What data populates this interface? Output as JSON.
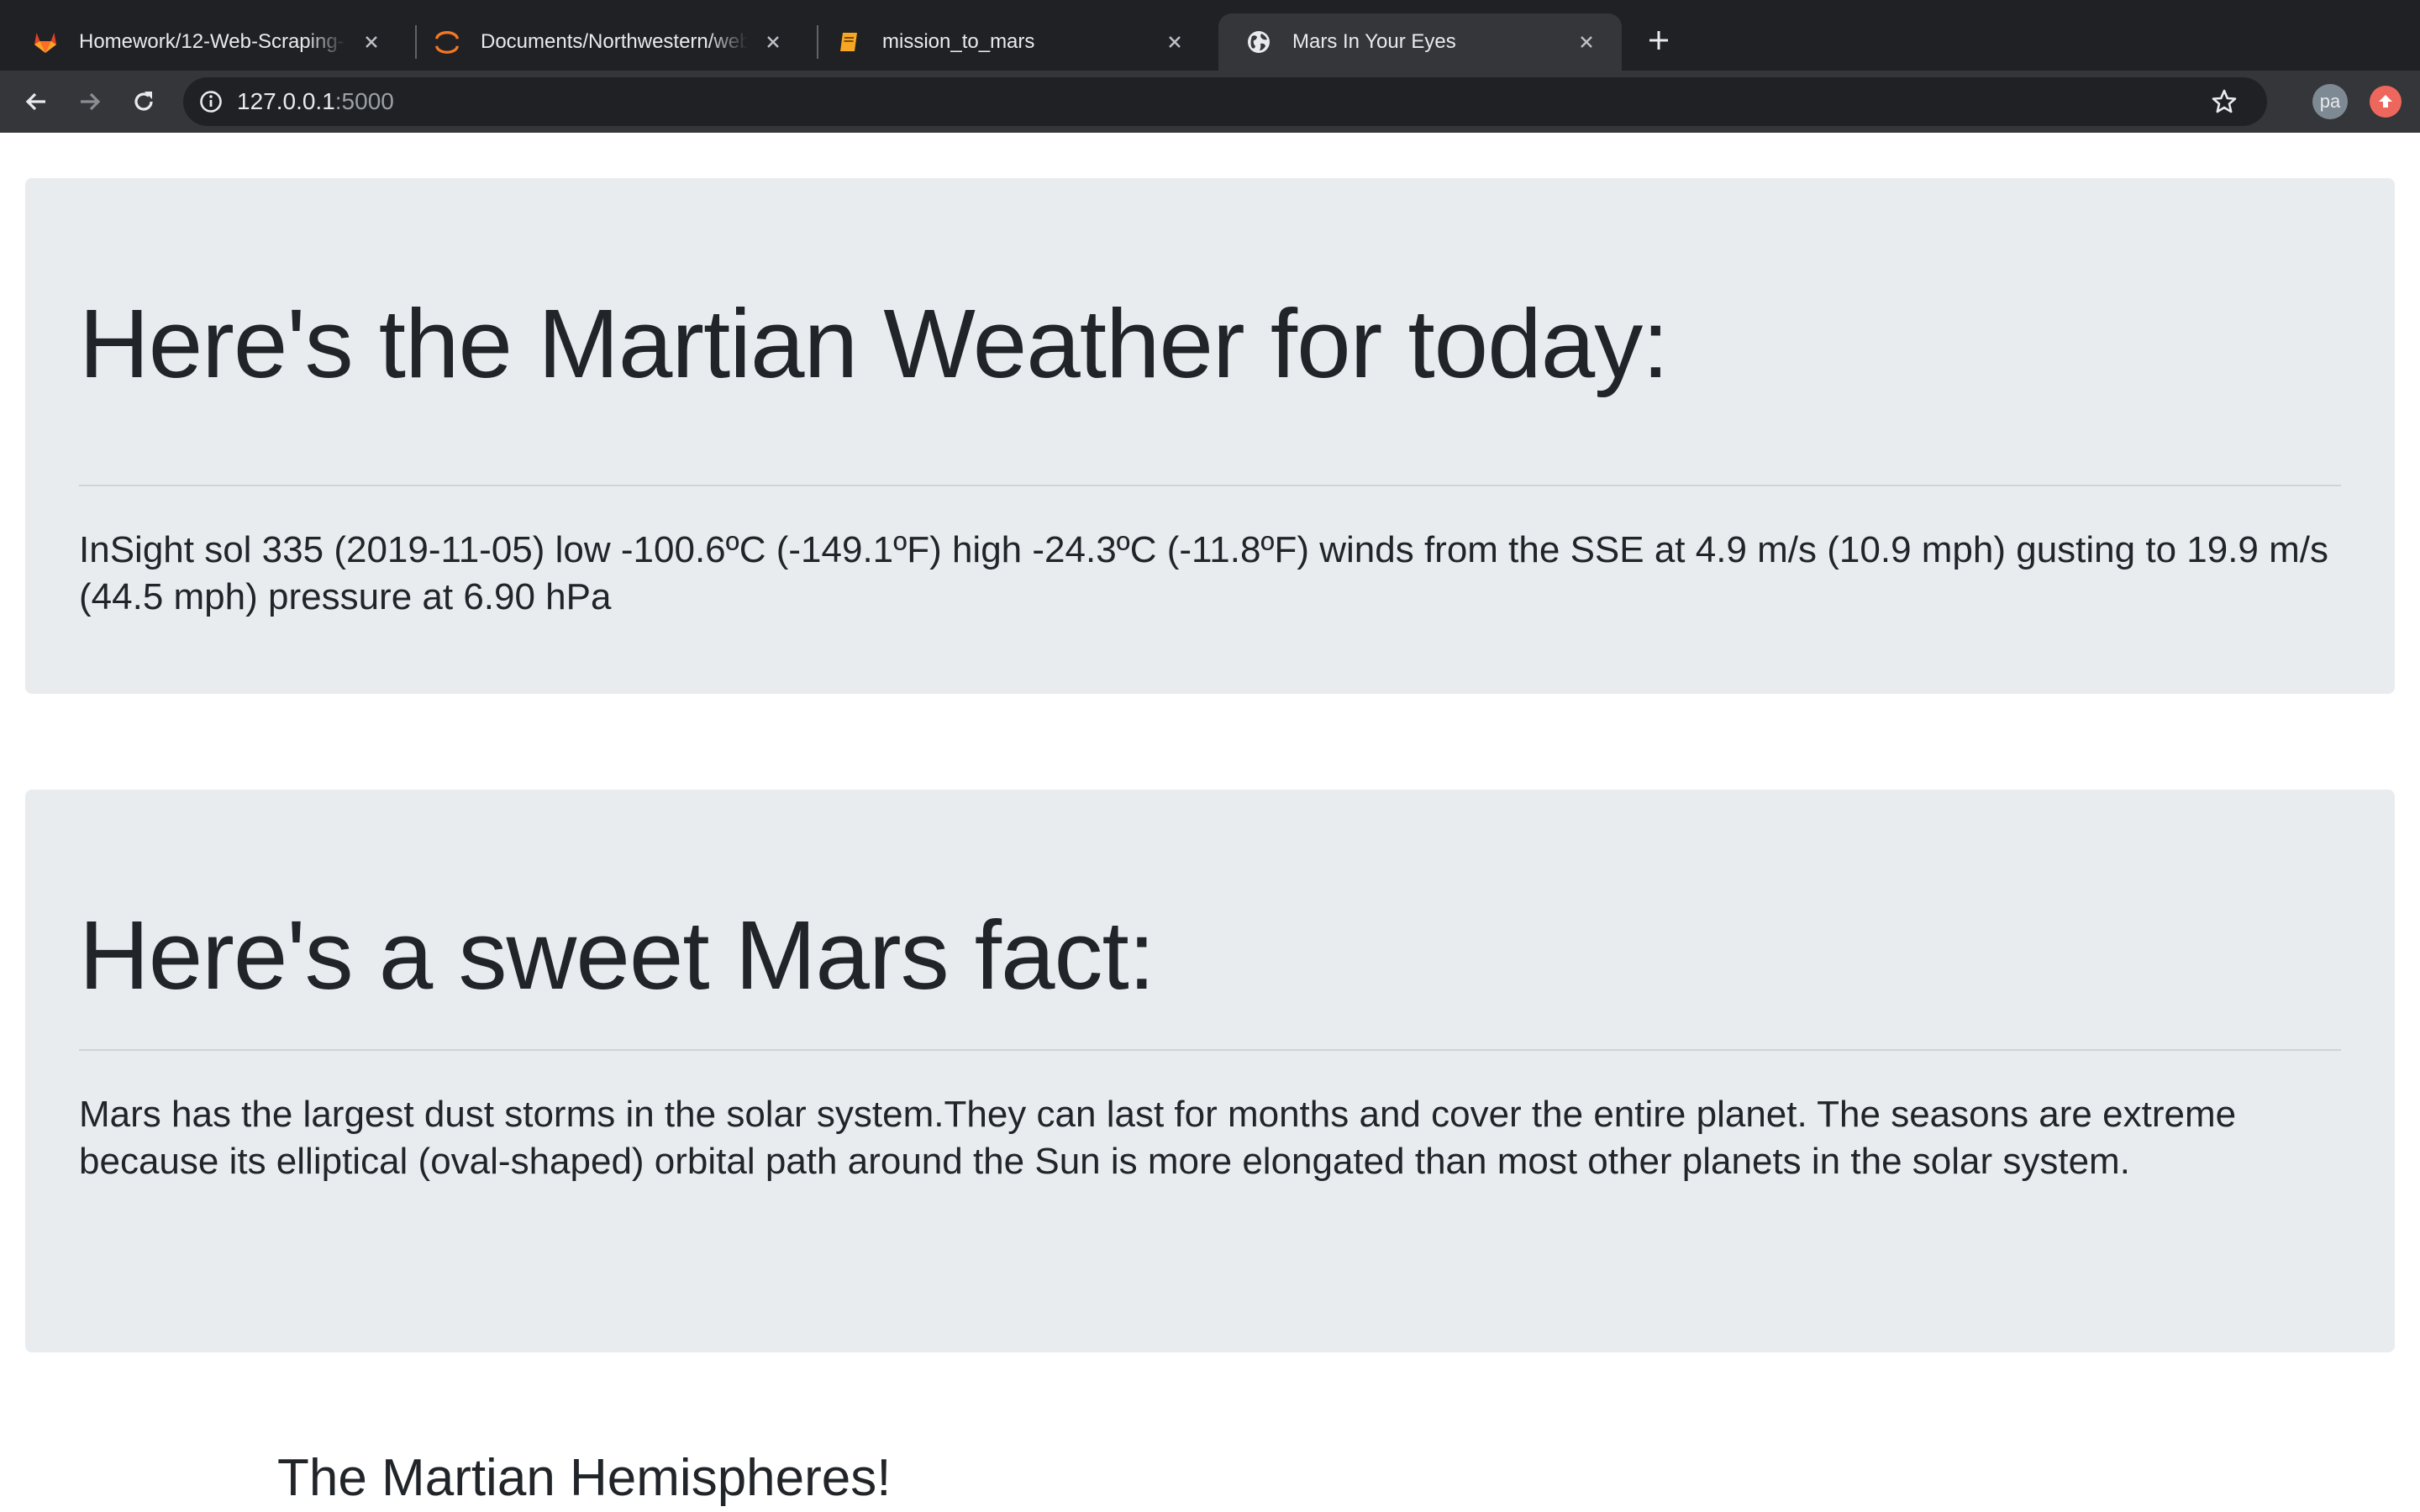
{
  "browser": {
    "tabs": [
      {
        "title": "Homework/12-Web-Scraping-a",
        "favicon": "gitlab-fox-icon",
        "active": false
      },
      {
        "title": "Documents/Northwestern/web",
        "favicon": "jupyter-icon",
        "active": false
      },
      {
        "title": "mission_to_mars",
        "favicon": "notebook-icon",
        "active": false
      },
      {
        "title": "Mars In Your Eyes",
        "favicon": "globe-icon",
        "active": true
      }
    ],
    "url_host": "127.0.0.1",
    "url_port": ":5000",
    "profile_initials": "pa"
  },
  "weather": {
    "heading": "Here's the Martian Weather for today:",
    "text": "InSight sol 335 (2019-11-05) low -100.6ºC (-149.1ºF) high -24.3ºC (-11.8ºF) winds from the SSE at 4.9 m/s (10.9 mph) gusting to 19.9 m/s (44.5 mph) pressure at 6.90 hPa"
  },
  "fact": {
    "heading": "Here's a sweet Mars fact:",
    "text": "Mars has the largest dust storms in the solar system.They can last for months and cover the entire planet. The seasons are extreme because its elliptical (oval-shaped) orbital path around the Sun is more elongated than most other planets in the solar system."
  },
  "hemispheres": {
    "heading": "The Martian Hemispheres!"
  },
  "colors": {
    "chrome_dark": "#202124",
    "chrome_toolbar": "#35363a",
    "jumbotron_bg": "#e9ecef",
    "update_badge": "#ee675c"
  }
}
